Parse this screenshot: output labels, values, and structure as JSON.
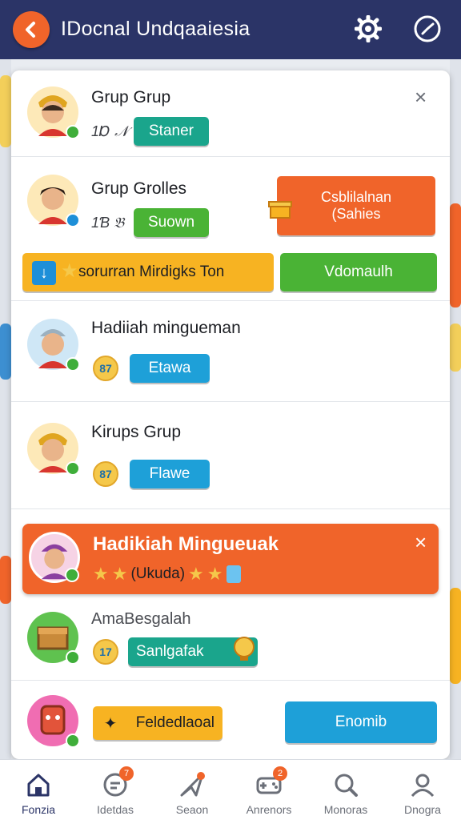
{
  "header": {
    "title": "IDocnal Undqaaiesia",
    "back_icon": "back-arrow-icon",
    "settings_icon": "gear-icon",
    "history_icon": "clock-icon",
    "bar_color": "#2b3467",
    "accent_color": "#f0642a"
  },
  "rows": [
    {
      "name": "Grup Grup",
      "sub": "1Ɒ 𝒩",
      "button": "Staner"
    },
    {
      "name": "Grup Grolles",
      "sub": "1Ɓ 𝔅",
      "button": "Suown",
      "side_button_line1": "Csblilalnan",
      "side_button_line2": "(Sahies",
      "banner_left": "sorurran Mirdigks Ton",
      "banner_right": "Vdomaulh"
    },
    {
      "name": "Hadiiah mingueman",
      "coin": "87",
      "button": "Etawa"
    },
    {
      "name": "Kirups Grup",
      "coin": "87",
      "button": "Flawe"
    }
  ],
  "highlight": {
    "title": "Hadikiah Mingueuak",
    "subtitle": "(Ukuda)",
    "color": "#f0642a"
  },
  "rows2": [
    {
      "name": "AmaBesgalah",
      "coin": "17",
      "button": "Sanlgafak"
    },
    {
      "button_left": "Feldedlaoal",
      "button_right": "Enomib"
    }
  ],
  "nav": [
    {
      "label": "Fonzia",
      "icon": "home-icon",
      "badge": ""
    },
    {
      "label": "Idetdas",
      "icon": "chat-icon",
      "badge": "7"
    },
    {
      "label": "Seaon",
      "icon": "send-icon",
      "badge": ""
    },
    {
      "label": "Anrenors",
      "icon": "gamepad-icon",
      "badge": "2"
    },
    {
      "label": "Monoras",
      "icon": "search-icon",
      "badge": ""
    },
    {
      "label": "Dnogra",
      "icon": "profile-icon",
      "badge": ""
    }
  ]
}
